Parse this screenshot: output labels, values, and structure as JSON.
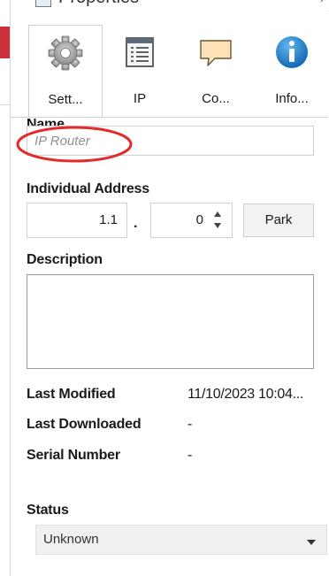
{
  "panel": {
    "title": "Properties"
  },
  "tabs": [
    {
      "label": "Sett...",
      "icon": "gear-icon",
      "active": true
    },
    {
      "label": "IP",
      "icon": "list-window-icon",
      "active": false
    },
    {
      "label": "Co...",
      "icon": "comment-bubble-icon",
      "active": false
    },
    {
      "label": "Info...",
      "icon": "info-icon",
      "active": false
    }
  ],
  "form": {
    "name_label": "Name",
    "name_placeholder": "IP Router",
    "address_label": "Individual Address",
    "area_line": "1.1",
    "device": "0",
    "park_label": "Park",
    "description_label": "Description",
    "description_value": ""
  },
  "info": {
    "last_modified_label": "Last Modified",
    "last_modified_value": "11/10/2023 10:04...",
    "last_downloaded_label": "Last Downloaded",
    "last_downloaded_value": "-",
    "serial_number_label": "Serial Number",
    "serial_number_value": "-"
  },
  "status": {
    "label": "Status",
    "selected": "Unknown"
  },
  "colors": {
    "highlight_ellipse": "#e32b2b",
    "host_red_bar": "#c9313b",
    "info_blue": "#1e8ad6",
    "comment_orange": "#e8a640"
  }
}
